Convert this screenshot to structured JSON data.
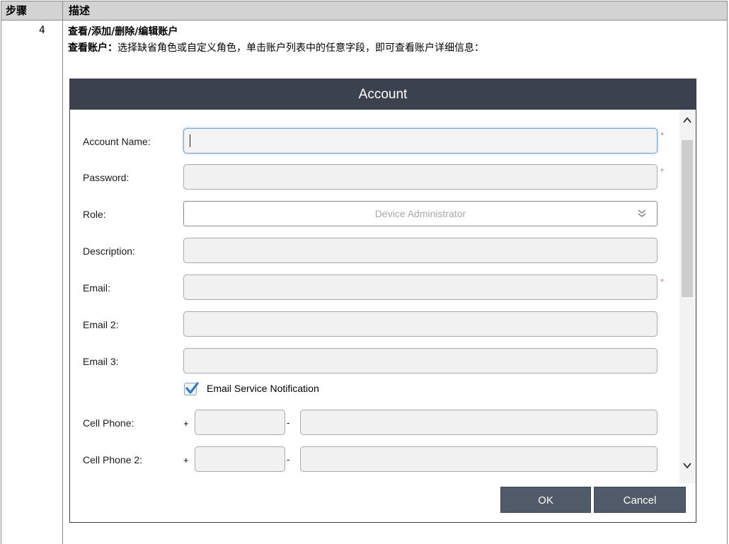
{
  "table": {
    "col_step": "步骤",
    "col_desc": "描述"
  },
  "row": {
    "step": "4",
    "title": "查看/添加/删除/编辑账户",
    "intro_bold": "查看账户：",
    "intro_text": "选择缺省角色或自定义角色，单击账户列表中的任意字段，即可查看账户详细信息："
  },
  "dialog": {
    "title": "Account",
    "labels": {
      "account_name": "Account Name:",
      "password": "Password:",
      "role": "Role:",
      "description": "Description:",
      "email": "Email:",
      "email2": "Email 2:",
      "email3": "Email 3:",
      "cell_phone": "Cell Phone:",
      "cell_phone2": "Cell Phone 2:"
    },
    "role_value": "Device Administrator",
    "required_marker": "*",
    "email_notification_label": "Email Service Notification",
    "email_notification_checked": true,
    "phone_plus": "+",
    "phone_dash": "-",
    "ok_label": "OK",
    "cancel_label": "Cancel"
  }
}
